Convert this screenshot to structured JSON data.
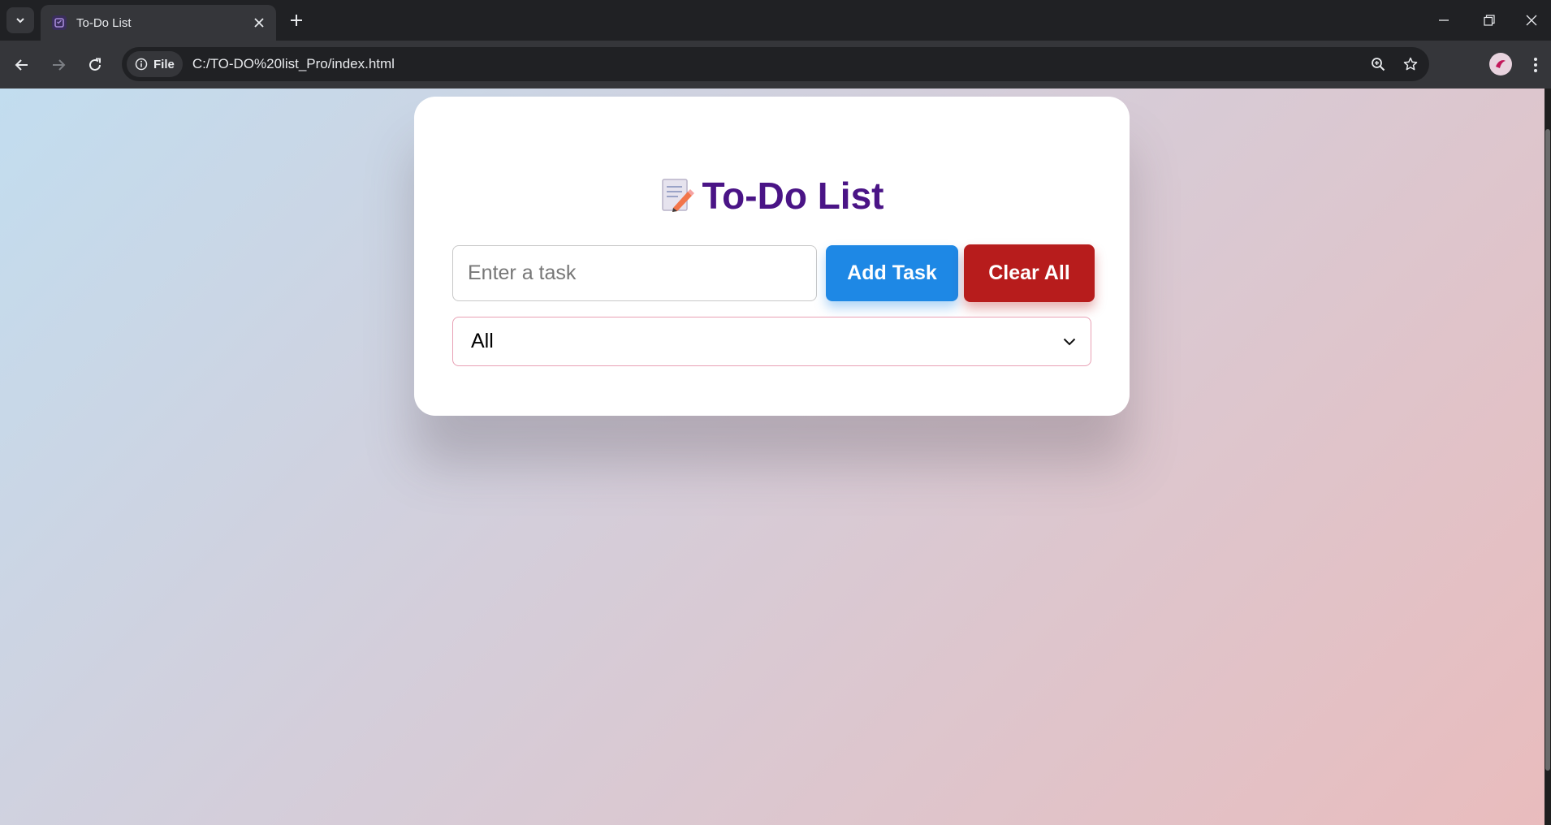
{
  "browser": {
    "tab_title": "To-Do List",
    "site_chip_label": "File",
    "url": "C:/TO-DO%20list_Pro/index.html"
  },
  "page": {
    "title_icon": "memo-icon",
    "title": "To-Do List",
    "task_input": {
      "value": "",
      "placeholder": "Enter a task"
    },
    "add_button_label": "Add Task",
    "clear_button_label": "Clear All",
    "filter": {
      "selected": "All"
    }
  },
  "colors": {
    "title": "#4a1486",
    "add_button": "#1e88e5",
    "clear_button": "#b71c1c",
    "gradient_start": "#c2ddef",
    "gradient_end": "#e9bcbd"
  }
}
